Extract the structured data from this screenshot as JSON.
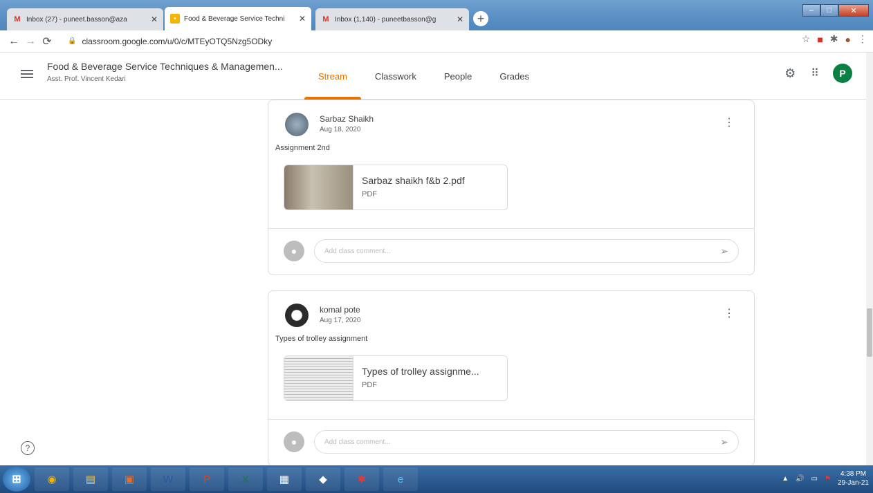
{
  "browser": {
    "tabs": [
      {
        "label": "Inbox (27) - puneet.basson@aza",
        "icon": "gmail-icon"
      },
      {
        "label": "Food & Beverage Service Techni",
        "icon": "classroom-icon"
      },
      {
        "label": "Inbox (1,140) - puneetbasson@g",
        "icon": "gmail-icon"
      }
    ],
    "url": "classroom.google.com/u/0/c/MTEyOTQ5Nzg5ODky"
  },
  "header": {
    "class_name": "Food & Beverage Service Techniques & Managemen...",
    "teacher": "Asst. Prof. Vincent Kedari",
    "tabs": [
      "Stream",
      "Classwork",
      "People",
      "Grades"
    ],
    "active_tab": "Stream",
    "profile_initial": "P"
  },
  "posts": [
    {
      "author": "Sarbaz Shaikh",
      "date": "Aug 18, 2020",
      "text": "Assignment 2nd",
      "attachment": {
        "name": "Sarbaz shaikh f&b 2.pdf",
        "type": "PDF"
      },
      "comment_placeholder": "Add class comment..."
    },
    {
      "author": "komal pote",
      "date": "Aug 17, 2020",
      "text": "Types of trolley assignment",
      "attachment": {
        "name": "Types of trolley assignme...",
        "type": "PDF"
      },
      "comment_placeholder": "Add class comment..."
    }
  ],
  "taskbar": {
    "time": "4:38 PM",
    "date": "29-Jan-21"
  },
  "colors": {
    "accent": "#e37400",
    "profile": "#0b8043"
  }
}
